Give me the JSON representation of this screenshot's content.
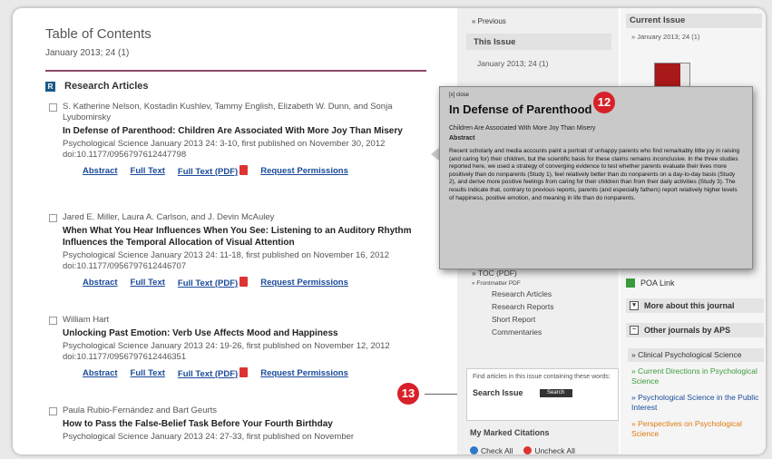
{
  "toc": {
    "title": "Table of Contents",
    "issue": "January 2013; 24 (1)",
    "section": "Research Articles",
    "section_icon": "R"
  },
  "articles": [
    {
      "authors": "S. Katherine Nelson, Kostadin Kushlev, Tammy English, Elizabeth W. Dunn, and Sonja Lyubomirsky",
      "title": "In Defense of Parenthood: Children Are Associated With More Joy Than Misery",
      "citation": "Psychological Science January 2013 24: 3-10, first published on November 30, 2012 doi:10.1177/0956797612447798"
    },
    {
      "authors": "Jared E. Miller, Laura A. Carlson, and J. Devin McAuley",
      "title": "When What You Hear Influences When You See: Listening to an Auditory Rhythm Influences the Temporal Allocation of Visual Attention",
      "citation": "Psychological Science January 2013 24: 11-18, first published on November 16, 2012 doi:10.1177/0956797612446707"
    },
    {
      "authors": "William Hart",
      "title": "Unlocking Past Emotion: Verb Use Affects Mood and Happiness",
      "citation": "Psychological Science January 2013 24: 19-26, first published on November 12, 2012 doi:10.1177/0956797612446351"
    },
    {
      "authors": "Paula Rubio-Fernández and Bart Geurts",
      "title": "How to Pass the False-Belief Task Before Your Fourth Birthday",
      "citation": "Psychological Science January 2013 24: 27-33, first published on November"
    }
  ],
  "article_links": {
    "abstract": "Abstract",
    "full_text": "Full Text",
    "full_text_pdf": "Full Text (PDF)",
    "permissions": "Request Permissions"
  },
  "middle": {
    "previous": "« Previous",
    "this_issue_head": "This Issue",
    "this_issue_val": "January 2013; 24 (1)",
    "toc_pdf": "» TOC (PDF)",
    "frontmatter": "» Frontmatter PDF",
    "sub_links": [
      "Research Articles",
      "Research Reports",
      "Short Report",
      "Commentaries"
    ],
    "search_hint": "Find articles in this issue containing these words:",
    "search_label": "Search Issue",
    "search_button": "Search",
    "marked_head": "My Marked Citations",
    "check_all": "Check All",
    "uncheck_all": "Uncheck All"
  },
  "right": {
    "current_head": "Current Issue",
    "current_val": "» January 2013; 24 (1)",
    "poa_link": "POA Link",
    "more_about": "More about this journal",
    "other_journals": "Other journals by APS",
    "journals": [
      {
        "name": "» Clinical Psychological Science",
        "color": "#333333",
        "bg": "#e4e4e4"
      },
      {
        "name": "» Current Directions in Psychological Science",
        "color": "#3b9a3b",
        "bg": "#f5f5f5"
      },
      {
        "name": "» Psychological Science in the Public Interest",
        "color": "#1a4a9a",
        "bg": "#f5f5f5"
      },
      {
        "name": "» Perspectives on Psychological Science",
        "color": "#e07a10",
        "bg": "#f5f5f5"
      }
    ]
  },
  "popup": {
    "close": "[x] close",
    "title": "In Defense of Parenthood",
    "subtitle": "Children Are Associated With More Joy Than Misery",
    "abstract_head": "Abstract",
    "abstract": "Recent scholarly and media accounts paint a portrait of unhappy parents who find remarkably little joy in raising (and caring for) their children, but the scientific basis for these claims remains inconclusive. In the three studies reported here, we used a strategy of converging evidence to test whether parents evaluate their lives more positively than do nonparents (Study 1), feel relatively better than do nonparents on a day-to-day basis (Study 2), and derive more positive feelings from caring for their children than from their daily activities (Study 3). The results indicate that, contrary to previous reports, parents (and especially fathers) report relatively higher levels of happiness, positive emotion, and meaning in life than do nonparents."
  },
  "callouts": {
    "c12": "12",
    "c13": "13"
  },
  "colors": {
    "accent": "#d8202a",
    "link": "#1a4a9a",
    "rule": "#8a4a6a"
  }
}
